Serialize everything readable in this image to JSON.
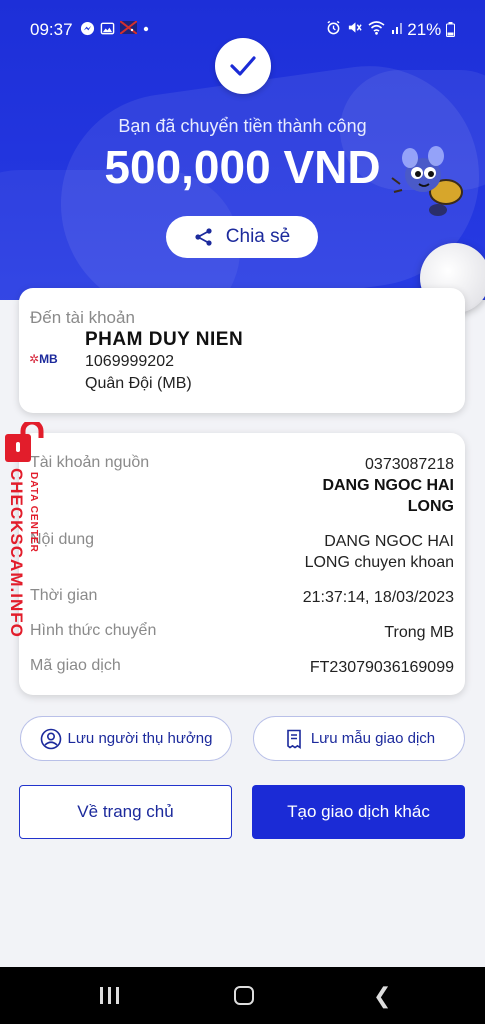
{
  "status_bar": {
    "time": "09:37",
    "battery": "21%",
    "icons_left": [
      "messenger-icon",
      "gallery-icon",
      "flag-icon",
      "dot-icon"
    ],
    "icons_right": [
      "alarm-icon",
      "mute-icon",
      "wifi-icon",
      "signal-icon",
      "battery-icon"
    ]
  },
  "result": {
    "message": "Bạn đã chuyển tiền thành công",
    "amount": "500,000 VND",
    "share_label": "Chia sẻ"
  },
  "recipient": {
    "label": "Đến tài khoản",
    "bank_logo": "MB",
    "name": "PHAM DUY NIEN",
    "account_number": "1069999202",
    "bank_name": "Quân Đội (MB)"
  },
  "details": {
    "source_account_label": "Tài khoản nguồn",
    "source_account_number": "0373087218",
    "source_account_name_line1": "DANG NGOC HAI",
    "source_account_name_line2": "LONG",
    "content_label": "Nội dung",
    "content_line1": "DANG NGOC HAI",
    "content_line2": "LONG chuyen khoan",
    "time_label": "Thời gian",
    "time_value": "21:37:14, 18/03/2023",
    "method_label": "Hình thức chuyển",
    "method_value": "Trong MB",
    "txn_label": "Mã giao dịch",
    "txn_value": "FT23079036169099"
  },
  "actions": {
    "save_beneficiary": "Lưu người thụ hưởng",
    "save_template": "Lưu mẫu giao dịch",
    "home": "Về trang chủ",
    "new_transaction": "Tạo giao dịch khác"
  },
  "watermark": {
    "brand": "CHECKSCAM.INFO",
    "sub": "DATA CENTER"
  },
  "colors": {
    "primary": "#1b2bd6",
    "hero": "#2437e0",
    "watermark": "#e21d2b"
  }
}
